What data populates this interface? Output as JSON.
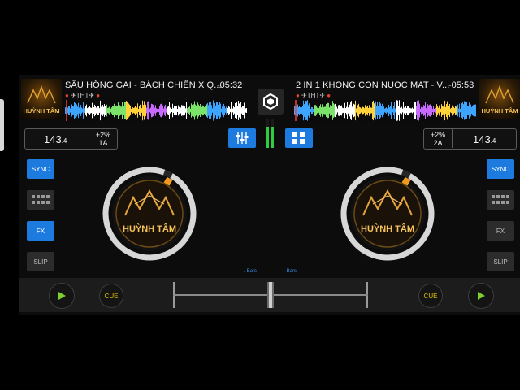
{
  "deck_left": {
    "title": "SẦU HỒNG GAI - BÁCH CHIẾN X Q...",
    "time": "-05:32",
    "artist": "THT",
    "bpm_main": "143",
    "bpm_dec": ".4",
    "pitch": "+2%",
    "key": "1A",
    "cover_text": "HUỲNH TÂM",
    "platter_text": "HUỲNH TÂM",
    "sync": "SYNC",
    "fx": "FX",
    "slip": "SLIP",
    "cue": "CUE",
    "bars": "-.-Bars",
    "ring_progress": 0.97
  },
  "deck_right": {
    "title": "2 IN 1 KHONG CON NUOC MAT - V...",
    "time": "-05:53",
    "artist": "THT",
    "bpm_main": "143",
    "bpm_dec": ".4",
    "pitch": "+2%",
    "key": "2A",
    "cover_text": "HUỲNH TÂM",
    "platter_text": "HUỲNH TÂM",
    "sync": "SYNC",
    "fx": "FX",
    "slip": "SLIP",
    "cue": "CUE",
    "bars": "-.-Bars",
    "ring_progress": 0.97
  },
  "colors": {
    "accent_blue": "#1d7be0",
    "ring_grey": "#d7d7d7",
    "ring_orange": "#f29a1e",
    "play_green": "#7ccf2e",
    "cue_yellow": "#e0c300",
    "vu_green": "#2ecc40"
  },
  "icons": {
    "mixer_left": "mixer-sliders-icon",
    "logo": "app-logo-icon",
    "grid_right": "grid-layout-icon",
    "pads": "pads-grid-icon",
    "play": "play-icon"
  }
}
